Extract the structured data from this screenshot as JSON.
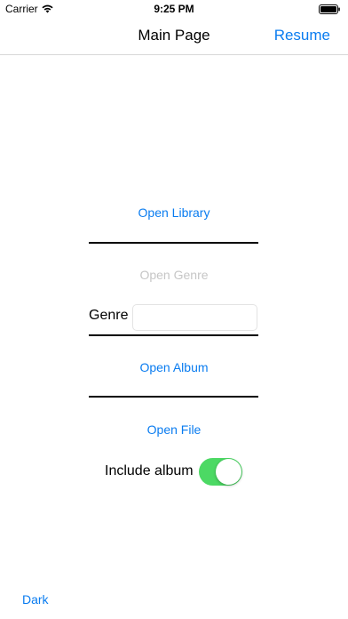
{
  "status_bar": {
    "carrier": "Carrier",
    "time": "9:25 PM",
    "wifi_icon": "wifi-icon",
    "battery_icon": "battery-icon"
  },
  "nav": {
    "title": "Main Page",
    "resume_label": "Resume"
  },
  "main": {
    "open_library_label": "Open Library",
    "open_genre_label": "Open Genre",
    "open_genre_enabled": false,
    "genre_label": "Genre",
    "genre_value": "",
    "genre_placeholder": "",
    "open_album_label": "Open Album",
    "open_file_label": "Open File",
    "include_album_label": "Include album",
    "include_album_on": true
  },
  "footer": {
    "dark_label": "Dark"
  },
  "colors": {
    "accent": "#0a7cf0",
    "disabled": "#c6c6c6",
    "toggle_on": "#4cd964"
  }
}
